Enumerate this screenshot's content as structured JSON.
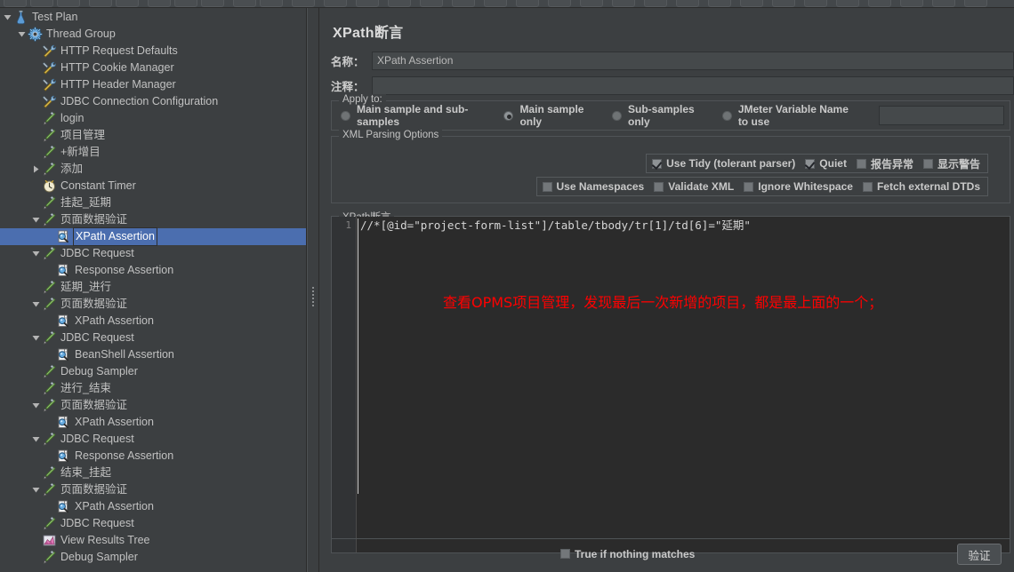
{
  "window": {
    "bg": "#3c3f41",
    "accent": "#4b6eaf",
    "annotation_color": "#ff0000"
  },
  "tree": {
    "selected_index": 13,
    "items": [
      {
        "label": "Test Plan",
        "depth": 0,
        "icon": "test-plan-icon",
        "twisty": "expanded"
      },
      {
        "label": "Thread Group",
        "depth": 1,
        "icon": "thread-group-icon",
        "twisty": "expanded"
      },
      {
        "label": "HTTP Request Defaults",
        "depth": 2,
        "icon": "config-element-icon",
        "twisty": "none"
      },
      {
        "label": "HTTP Cookie Manager",
        "depth": 2,
        "icon": "config-element-icon",
        "twisty": "none"
      },
      {
        "label": "HTTP Header Manager",
        "depth": 2,
        "icon": "config-element-icon",
        "twisty": "none"
      },
      {
        "label": "JDBC Connection Configuration",
        "depth": 2,
        "icon": "config-element-icon",
        "twisty": "none"
      },
      {
        "label": "login",
        "depth": 2,
        "icon": "sampler-icon",
        "twisty": "none"
      },
      {
        "label": "项目管理",
        "depth": 2,
        "icon": "sampler-icon",
        "twisty": "none"
      },
      {
        "label": "+新增目",
        "depth": 2,
        "icon": "sampler-icon",
        "twisty": "none"
      },
      {
        "label": "添加",
        "depth": 2,
        "icon": "sampler-icon",
        "twisty": "collapsed"
      },
      {
        "label": "Constant Timer",
        "depth": 2,
        "icon": "timer-icon",
        "twisty": "none"
      },
      {
        "label": "挂起_延期",
        "depth": 2,
        "icon": "sampler-icon",
        "twisty": "none"
      },
      {
        "label": "页面数据验证",
        "depth": 2,
        "icon": "sampler-icon",
        "twisty": "expanded"
      },
      {
        "label": "XPath Assertion",
        "depth": 3,
        "icon": "assertion-icon",
        "twisty": "none"
      },
      {
        "label": "JDBC Request",
        "depth": 2,
        "icon": "sampler-icon",
        "twisty": "expanded"
      },
      {
        "label": "Response Assertion",
        "depth": 3,
        "icon": "assertion-icon",
        "twisty": "none"
      },
      {
        "label": "延期_进行",
        "depth": 2,
        "icon": "sampler-icon",
        "twisty": "none"
      },
      {
        "label": "页面数据验证",
        "depth": 2,
        "icon": "sampler-icon",
        "twisty": "expanded"
      },
      {
        "label": "XPath Assertion",
        "depth": 3,
        "icon": "assertion-icon",
        "twisty": "none"
      },
      {
        "label": "JDBC Request",
        "depth": 2,
        "icon": "sampler-icon",
        "twisty": "expanded"
      },
      {
        "label": "BeanShell Assertion",
        "depth": 3,
        "icon": "assertion-icon",
        "twisty": "none"
      },
      {
        "label": "Debug Sampler",
        "depth": 2,
        "icon": "sampler-icon",
        "twisty": "none"
      },
      {
        "label": "进行_结束",
        "depth": 2,
        "icon": "sampler-icon",
        "twisty": "none"
      },
      {
        "label": "页面数据验证",
        "depth": 2,
        "icon": "sampler-icon",
        "twisty": "expanded"
      },
      {
        "label": "XPath Assertion",
        "depth": 3,
        "icon": "assertion-icon",
        "twisty": "none"
      },
      {
        "label": "JDBC Request",
        "depth": 2,
        "icon": "sampler-icon",
        "twisty": "expanded"
      },
      {
        "label": "Response Assertion",
        "depth": 3,
        "icon": "assertion-icon",
        "twisty": "none"
      },
      {
        "label": "结束_挂起",
        "depth": 2,
        "icon": "sampler-icon",
        "twisty": "none"
      },
      {
        "label": "页面数据验证",
        "depth": 2,
        "icon": "sampler-icon",
        "twisty": "expanded"
      },
      {
        "label": "XPath Assertion",
        "depth": 3,
        "icon": "assertion-icon",
        "twisty": "none"
      },
      {
        "label": "JDBC Request",
        "depth": 2,
        "icon": "sampler-icon",
        "twisty": "none"
      },
      {
        "label": "View Results Tree",
        "depth": 2,
        "icon": "view-results-tree-icon",
        "twisty": "none"
      },
      {
        "label": "Debug Sampler",
        "depth": 2,
        "icon": "sampler-icon",
        "twisty": "none"
      }
    ]
  },
  "panel": {
    "title": "XPath断言",
    "name_label": "名称：",
    "name_value": "XPath Assertion",
    "comment_label": "注释：",
    "comment_value": "",
    "apply_to": {
      "legend": "Apply to:",
      "options": [
        {
          "label": "Main sample and sub-samples",
          "checked": false
        },
        {
          "label": "Main sample only",
          "checked": true
        },
        {
          "label": "Sub-samples only",
          "checked": false
        },
        {
          "label": "JMeter Variable Name to use",
          "checked": false
        }
      ],
      "variable_value": ""
    },
    "xml_parsing": {
      "legend": "XML Parsing Options",
      "row1": [
        {
          "label": "Use Tidy (tolerant parser)",
          "checked": true
        },
        {
          "label": "Quiet",
          "checked": true
        },
        {
          "label": "报告异常",
          "checked": false
        },
        {
          "label": "显示警告",
          "checked": false
        }
      ],
      "row2": [
        {
          "label": "Use Namespaces",
          "checked": false
        },
        {
          "label": "Validate XML",
          "checked": false
        },
        {
          "label": "Ignore Whitespace",
          "checked": false
        },
        {
          "label": "Fetch external DTDs",
          "checked": false
        }
      ]
    },
    "xpath_editor": {
      "legend": "XPath断言",
      "line_number": "1",
      "code": "//*[@id=\"project-form-list\"]/table/tbody/tr[1]/td[6]=\"延期\"",
      "annotation": "查看OPMS项目管理，发现最后一次新增的项目，都是最上面的一个；"
    },
    "footer": {
      "true_if_nothing_matches_label": "True if nothing matches",
      "true_if_nothing_matches_checked": false,
      "verify_button_label": "验证"
    }
  }
}
